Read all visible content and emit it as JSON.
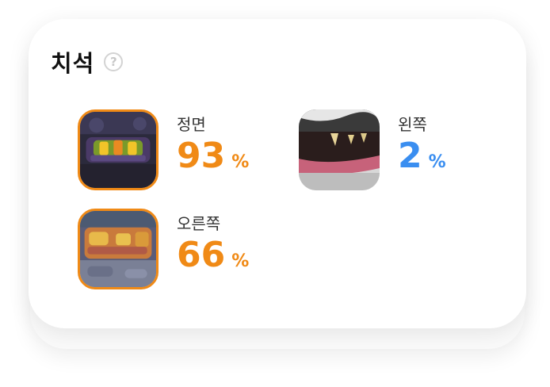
{
  "card": {
    "title": "치석",
    "help_icon": "question-circle-icon",
    "help_glyph": "?"
  },
  "items": [
    {
      "label": "정면",
      "value": "93",
      "unit": "%",
      "status_color": "#f08a16",
      "highlighted": true
    },
    {
      "label": "왼쪽",
      "value": "2",
      "unit": "%",
      "status_color": "#3a8ef0",
      "highlighted": false
    },
    {
      "label": "오른쪽",
      "value": "66",
      "unit": "%",
      "status_color": "#f08a16",
      "highlighted": true
    }
  ],
  "colors": {
    "warning": "#f08a16",
    "good": "#3a8ef0",
    "title": "#111111"
  }
}
